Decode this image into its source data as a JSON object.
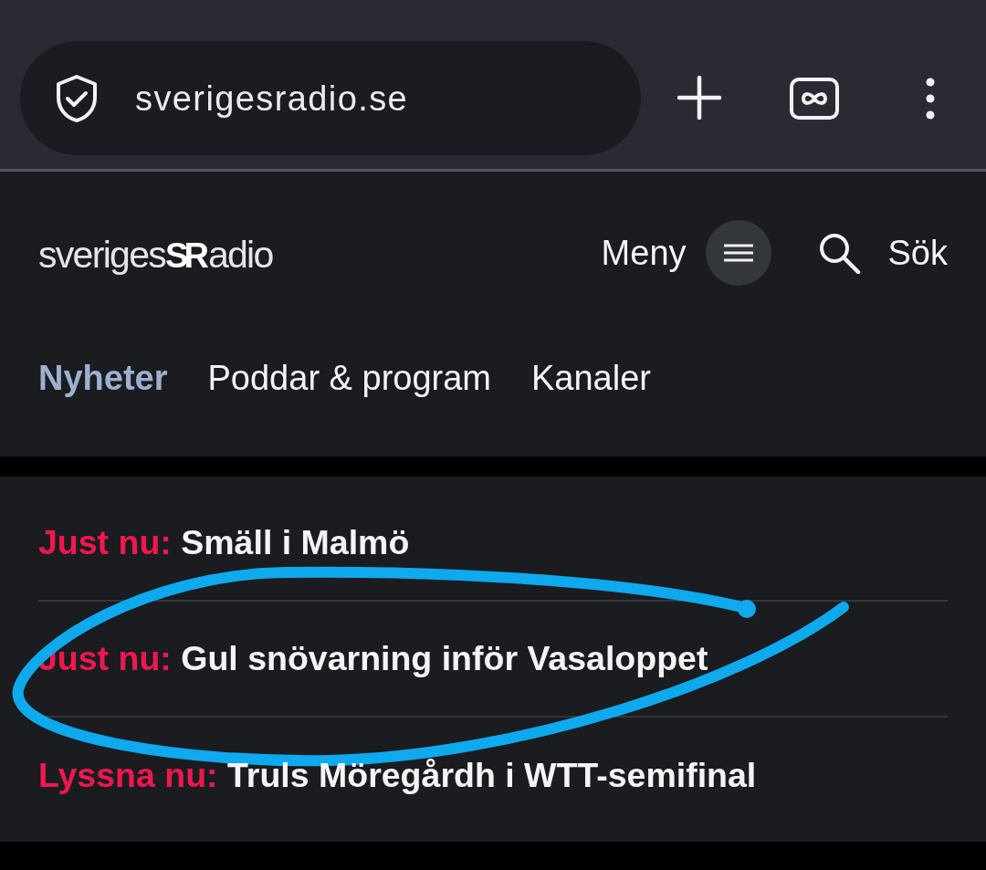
{
  "browser": {
    "url": "sverigesradio.se"
  },
  "header": {
    "logo": {
      "text_1": "sveriges",
      "mark": "SR",
      "text_2": "adio"
    },
    "menu_label": "Meny",
    "search_label": "Sök"
  },
  "nav": [
    {
      "label": "Nyheter",
      "selected": true
    },
    {
      "label": "Poddar & program",
      "selected": false
    },
    {
      "label": "Kanaler",
      "selected": false
    }
  ],
  "headlines": [
    {
      "prefix": "Just nu:",
      "title": "Smäll i Malmö",
      "circled": false
    },
    {
      "prefix": "Just nu:",
      "title": "Gul snövarning inför Vasaloppet",
      "circled": true
    },
    {
      "prefix": "Lyssna nu:",
      "title": "Truls Möregårdh i WTT-semifinal",
      "circled": false
    }
  ]
}
